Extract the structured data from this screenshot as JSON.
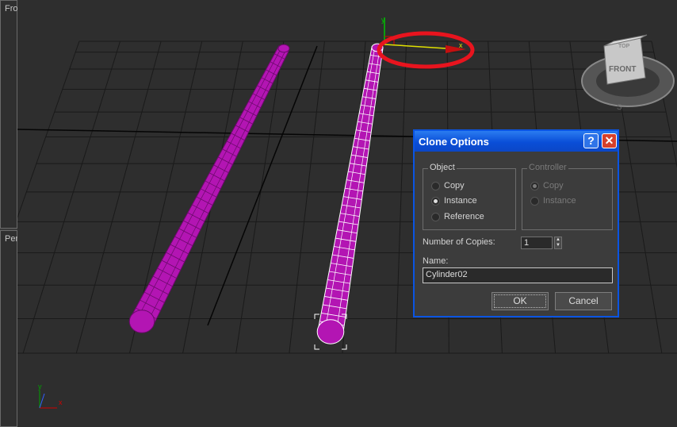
{
  "viewports": {
    "front_label": "Fro",
    "persp_label": "Per"
  },
  "gizmo": {
    "y_axis": "y",
    "x_axis": "x"
  },
  "viewcube": {
    "top_label": "TOP",
    "front_label": "FRONT",
    "compass_s": "S"
  },
  "corner_axes": {
    "x": "x",
    "y": "y",
    "z": "z"
  },
  "colors": {
    "cylinder": "#b315b3",
    "selection": "#ffffff",
    "annotation": "#e8141e",
    "title_bar": "#0a4ed8"
  },
  "dialog": {
    "title": "Clone Options",
    "help_label": "?",
    "close_label": "✕",
    "object_group": {
      "title": "Object",
      "options": [
        {
          "label": "Copy",
          "selected": false
        },
        {
          "label": "Instance",
          "selected": true
        },
        {
          "label": "Reference",
          "selected": false
        }
      ]
    },
    "controller_group": {
      "title": "Controller",
      "options": [
        {
          "label": "Copy",
          "selected": true
        },
        {
          "label": "Instance",
          "selected": false
        }
      ]
    },
    "copies_label": "Number of Copies:",
    "copies_value": "1",
    "name_label": "Name:",
    "name_value": "Cylinder02",
    "ok_label": "OK",
    "cancel_label": "Cancel"
  }
}
